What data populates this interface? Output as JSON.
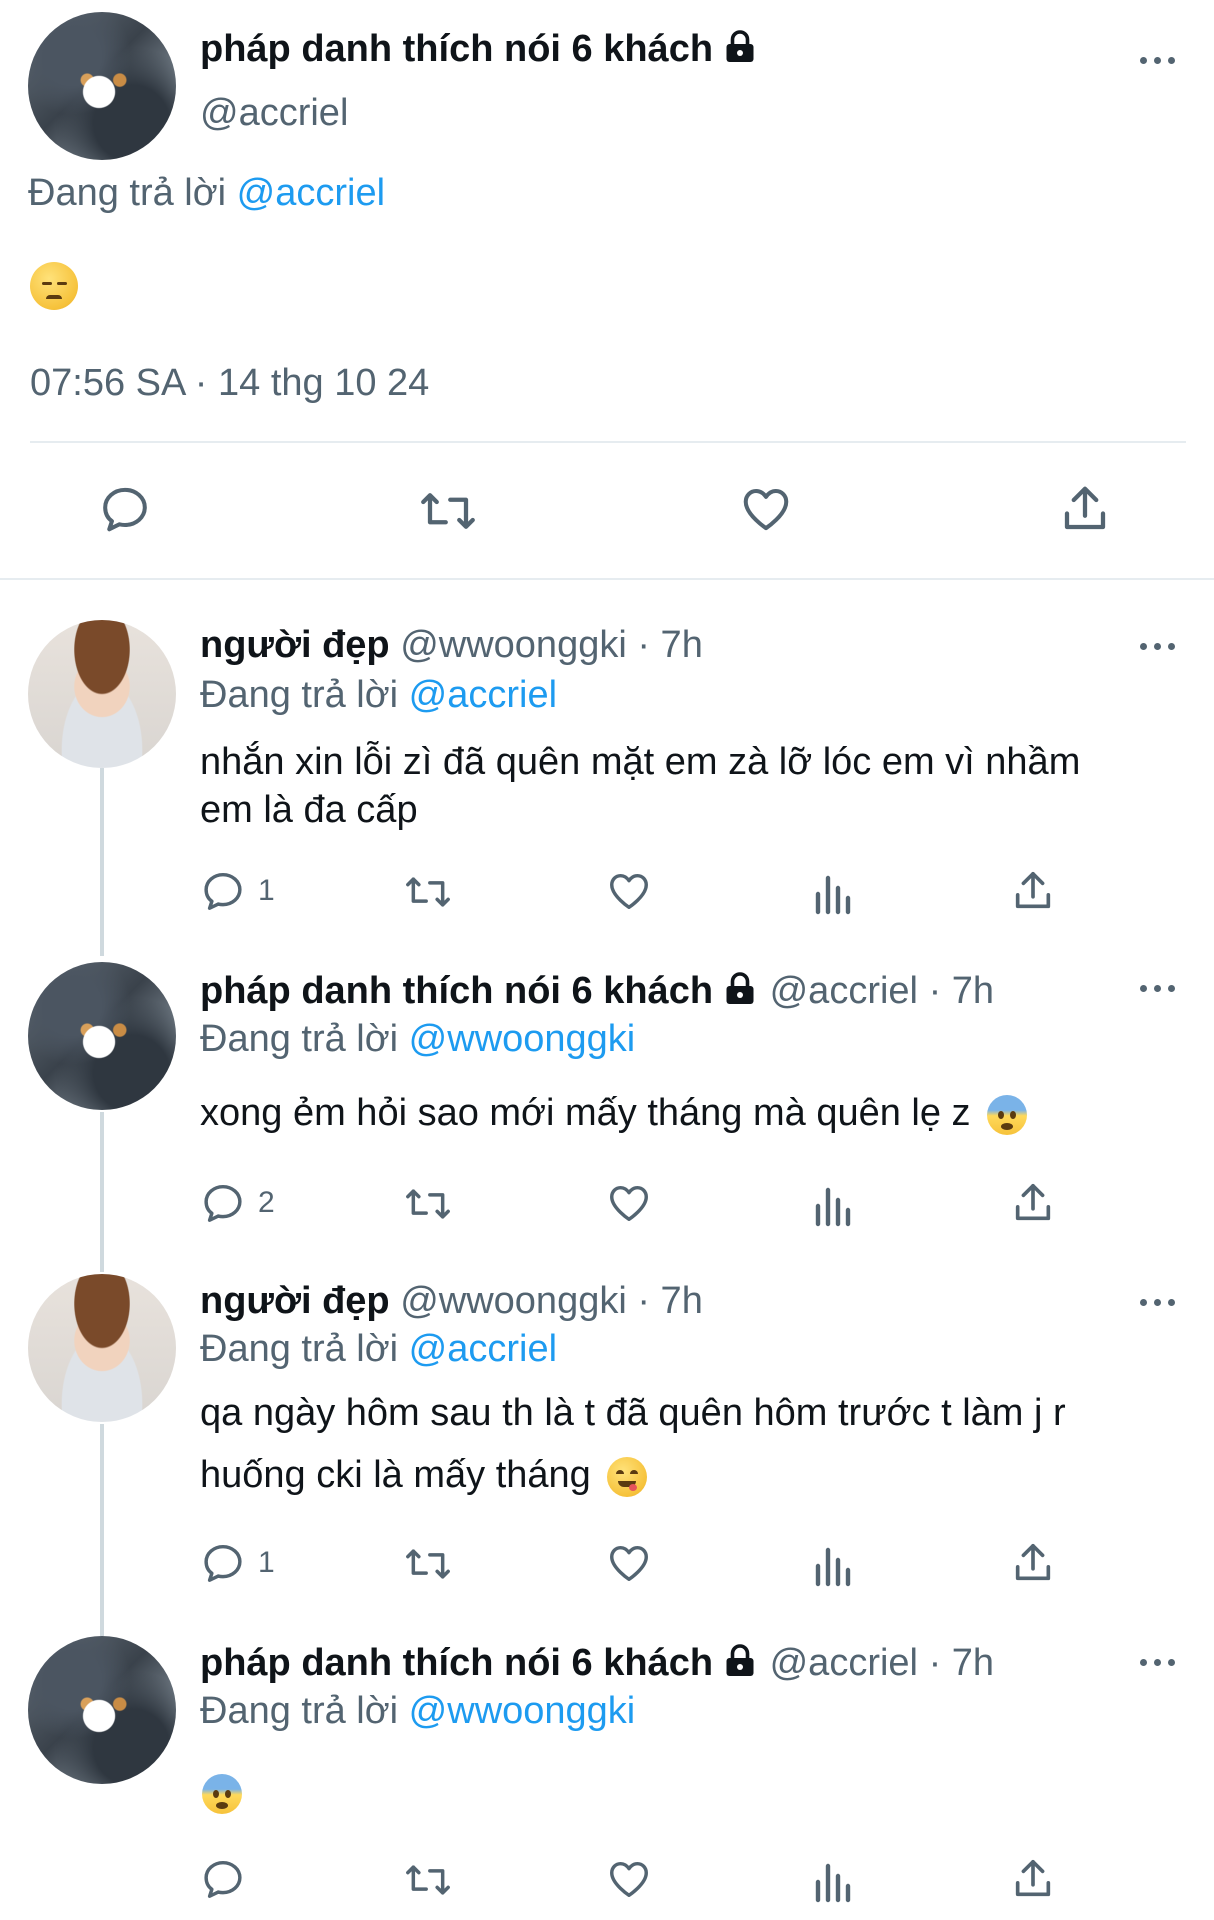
{
  "main_tweet": {
    "display_name": "pháp danh thích nói 6 khách",
    "handle": "@accriel",
    "replying_prefix": "Đang trả lời",
    "replying_to": "@accriel",
    "body_emoji": "😞",
    "timestamp": "07:56 SA · 14 thg 10 24"
  },
  "replies": [
    {
      "display_name": "người đẹp",
      "handle": "@wwoonggki",
      "time": "· 7h",
      "replying_prefix": "Đang trả lời",
      "replying_to": "@accriel",
      "text_lines": [
        "nhắn xin lỗi zì đã quên mặt em zà lỡ lóc em vì nhầm",
        "em là đa cấp"
      ],
      "reply_count": "1"
    },
    {
      "display_name": "pháp danh thích nói 6 khách",
      "handle": "@accriel",
      "time": "· 7h",
      "replying_prefix": "Đang trả lời",
      "replying_to": "@wwoonggki",
      "text": "xong ẻm hỏi sao mới mấy tháng mà quên lẹ z",
      "emoji": "😨",
      "reply_count": "2"
    },
    {
      "display_name": "người đẹp",
      "handle": "@wwoonggki",
      "time": "· 7h",
      "replying_prefix": "Đang trả lời",
      "replying_to": "@accriel",
      "text_line1": "qa ngày hôm sau th là t đã quên hôm trước t làm j r",
      "text_line2": "huống cki là mấy tháng",
      "emoji": "😋",
      "reply_count": "1"
    },
    {
      "display_name": "pháp danh thích nói 6 khách",
      "handle": "@accriel",
      "time": "· 7h",
      "replying_prefix": "Đang trả lời",
      "replying_to": "@wwoonggki",
      "emoji": "😨",
      "reply_count": ""
    }
  ],
  "icons": [
    "reply-icon",
    "retweet-icon",
    "like-icon",
    "views-icon",
    "share-icon",
    "lock-icon",
    "more-icon"
  ],
  "colors": {
    "link": "#1d9bf0",
    "secondary": "#536471",
    "divider": "#cfd9de"
  }
}
